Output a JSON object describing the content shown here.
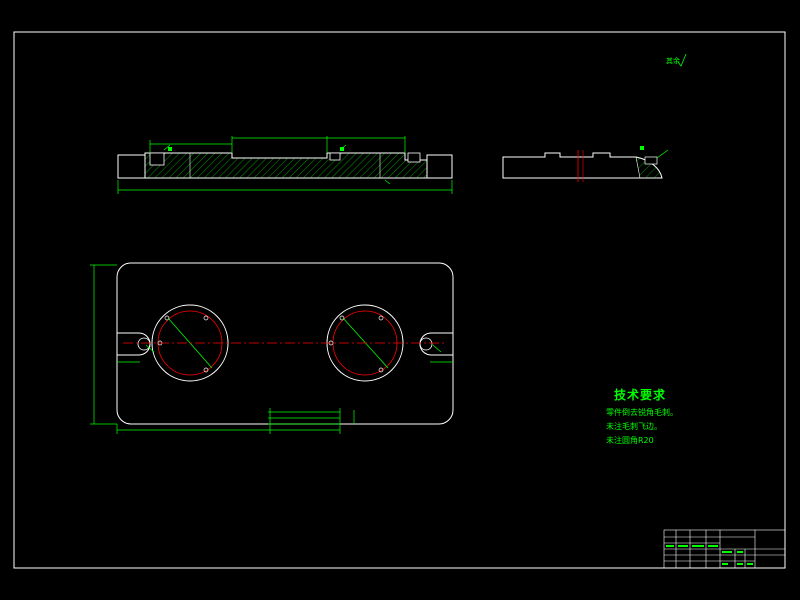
{
  "tech_requirements": {
    "title": "技术要求",
    "lines": [
      "零件倒去锐角毛刺。",
      "未注毛刺飞边。",
      "未注圆角R20"
    ]
  },
  "roughness_note": "其余",
  "colors": {
    "background": "#000000",
    "frame": "#ffffff",
    "dimension": "#00ff00",
    "centerline": "#ff0000",
    "hatch": "#00ff00",
    "outline": "#ffffff"
  }
}
